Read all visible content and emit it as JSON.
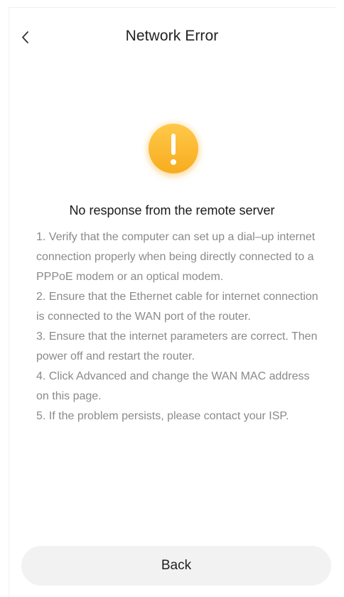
{
  "header": {
    "title": "Network Error",
    "back_icon": "chevron-left-icon"
  },
  "alert": {
    "icon": "exclamation-icon",
    "color": "#f8ac1e"
  },
  "message": {
    "heading": "No response from the remote server",
    "steps": [
      "1. Verify that the computer can set up a dial–up internet connection properly when being directly connected to a PPPoE modem or an optical modem.",
      "2. Ensure that the Ethernet cable for internet connection is connected to the WAN port of the router.",
      "3. Ensure that the internet parameters are correct. Then power off and restart the router.",
      "4. Click Advanced and change the WAN MAC address on this page.",
      "5. If the problem persists, please contact your ISP."
    ]
  },
  "footer": {
    "back_label": "Back"
  }
}
